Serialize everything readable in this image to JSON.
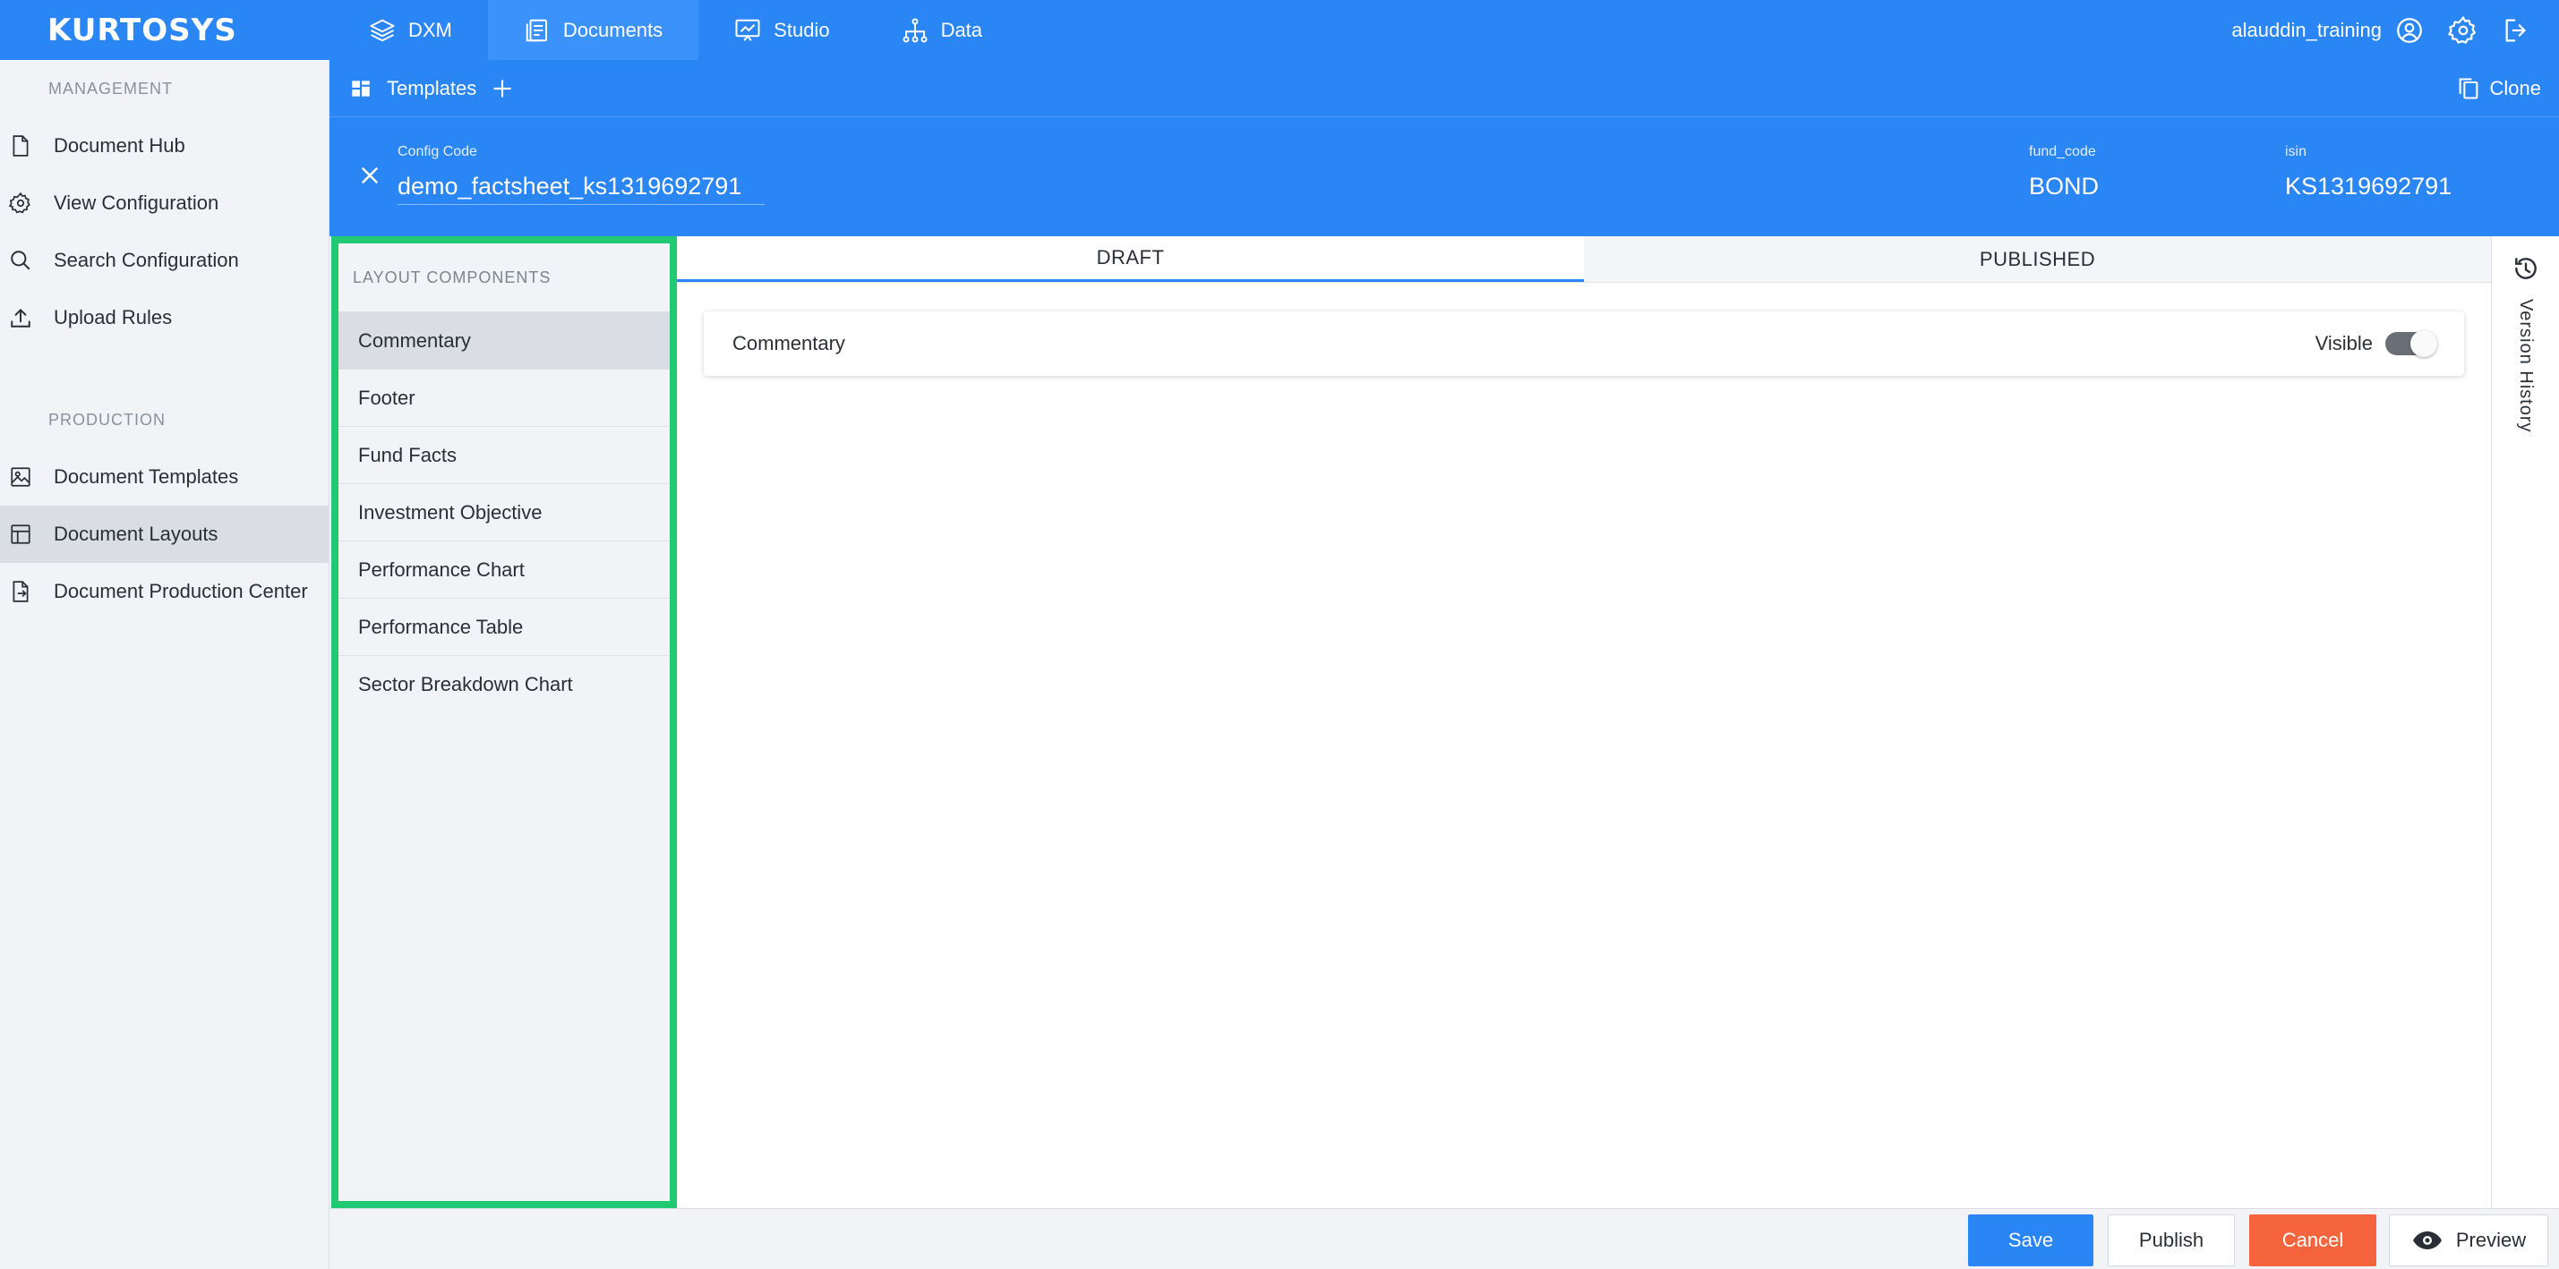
{
  "brand": "KURTOSYS",
  "nav": {
    "items": [
      {
        "label": "DXM",
        "icon": "layers-icon"
      },
      {
        "label": "Documents",
        "icon": "document-icon"
      },
      {
        "label": "Studio",
        "icon": "presentation-icon"
      },
      {
        "label": "Data",
        "icon": "hierarchy-icon"
      }
    ],
    "active": "Documents",
    "username": "alauddin_training"
  },
  "sidebar": {
    "management_title": "MANAGEMENT",
    "management_items": [
      {
        "label": "Document Hub",
        "icon": "file-icon"
      },
      {
        "label": "View Configuration",
        "icon": "gear-icon"
      },
      {
        "label": "Search Configuration",
        "icon": "search-icon"
      },
      {
        "label": "Upload Rules",
        "icon": "upload-icon"
      }
    ],
    "production_title": "PRODUCTION",
    "production_items": [
      {
        "label": "Document Templates",
        "icon": "image-icon"
      },
      {
        "label": "Document Layouts",
        "icon": "layout-icon"
      },
      {
        "label": "Document Production Center",
        "icon": "file-export-icon"
      }
    ],
    "active": "Document Layouts"
  },
  "subbar": {
    "templates_label": "Templates",
    "clone_label": "Clone"
  },
  "config": {
    "code_label": "Config Code",
    "code_value": "demo_factsheet_ks1319692791",
    "fund_label": "fund_code",
    "fund_value": "BOND",
    "isin_label": "isin",
    "isin_value": "KS1319692791"
  },
  "components": {
    "title": "LAYOUT COMPONENTS",
    "items": [
      "Commentary",
      "Footer",
      "Fund Facts",
      "Investment Objective",
      "Performance Chart",
      "Performance Table",
      "Sector Breakdown Chart"
    ],
    "active": "Commentary"
  },
  "tabs": {
    "draft": "DRAFT",
    "published": "PUBLISHED",
    "active": "DRAFT"
  },
  "card": {
    "title": "Commentary",
    "visible_label": "Visible",
    "visible": true
  },
  "version_history_label": "Version History",
  "actions": {
    "save": "Save",
    "publish": "Publish",
    "cancel": "Cancel",
    "preview": "Preview"
  },
  "colors": {
    "primary": "#2a85f5",
    "highlight_border": "#22c973",
    "cancel": "#f5643c"
  }
}
